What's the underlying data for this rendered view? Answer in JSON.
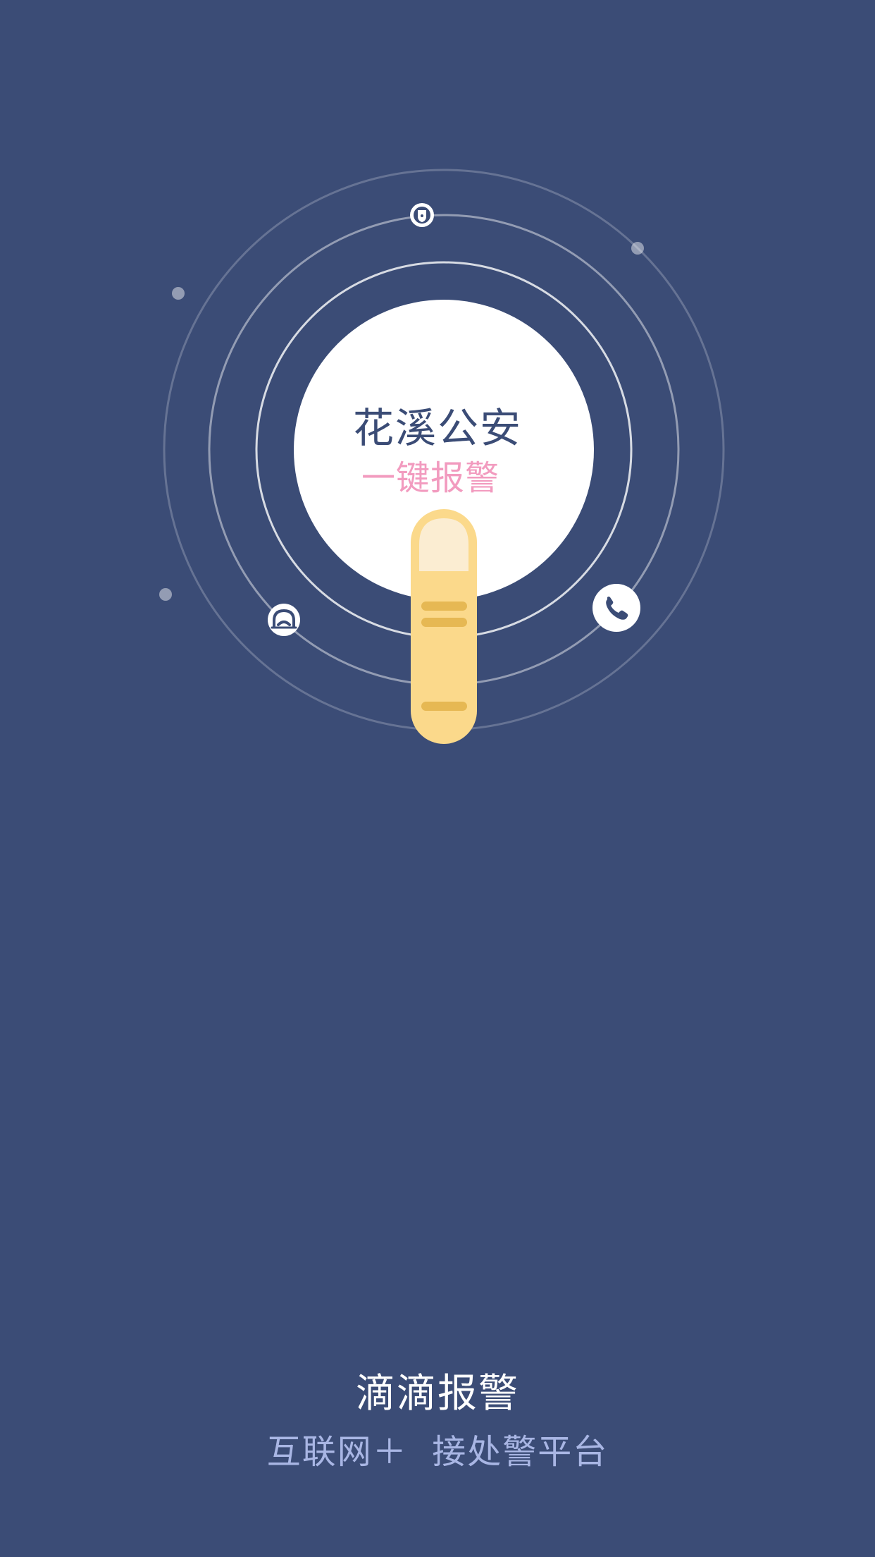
{
  "colors": {
    "background": "#3B4C76",
    "accent_pink": "#F29BBF",
    "finger_yellow": "#FBD98B",
    "finger_crease": "#E6B853",
    "nail": "#FBEDD2",
    "tagline": "#A9B6E4",
    "white": "#FFFFFF"
  },
  "hero": {
    "title": "花溪公安",
    "subtitle": "一键报警",
    "icons": [
      "police-badge-icon",
      "police-cap-icon",
      "phone-icon",
      "tap-finger-icon"
    ]
  },
  "footer": {
    "app_name": "滴滴报警",
    "tagline": "互联网＋  接处警平台"
  }
}
